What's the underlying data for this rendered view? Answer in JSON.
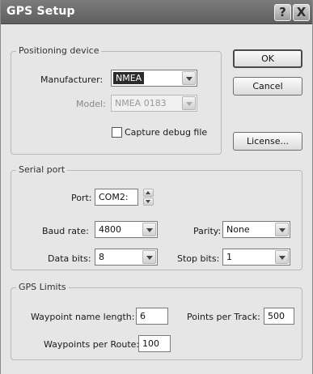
{
  "window": {
    "title": "GPS Setup",
    "help_label": "?",
    "close_label": "X"
  },
  "positioning": {
    "legend": "Positioning device",
    "manufacturer_label": "Manufacturer:",
    "manufacturer_value": "NMEA",
    "model_label": "Model:",
    "model_value": "NMEA 0183",
    "capture_label": "Capture debug file",
    "capture_checked": false
  },
  "buttons": {
    "ok": "OK",
    "cancel": "Cancel",
    "license": "License..."
  },
  "serial": {
    "legend": "Serial port",
    "port_label": "Port:",
    "port_value": "COM2:",
    "baud_label": "Baud rate:",
    "baud_value": "4800",
    "parity_label": "Parity:",
    "parity_value": "None",
    "databits_label": "Data bits:",
    "databits_value": "8",
    "stopbits_label": "Stop bits:",
    "stopbits_value": "1"
  },
  "limits": {
    "legend": "GPS Limits",
    "waypoint_name_label": "Waypoint name length:",
    "waypoint_name_value": "6",
    "points_track_label": "Points per Track:",
    "points_track_value": "500",
    "waypoints_route_label": "Waypoints per Route:",
    "waypoints_route_value": "100"
  }
}
